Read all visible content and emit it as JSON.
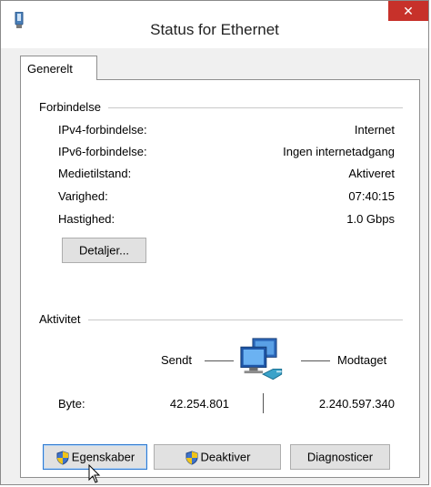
{
  "window": {
    "title": "Status for Ethernet",
    "close_glyph": "✕"
  },
  "tabs": [
    {
      "label": "Generelt"
    }
  ],
  "connection": {
    "section_label": "Forbindelse",
    "rows": [
      {
        "label": "IPv4-forbindelse:",
        "value": "Internet"
      },
      {
        "label": "IPv6-forbindelse:",
        "value": "Ingen internetadgang"
      },
      {
        "label": "Medietilstand:",
        "value": "Aktiveret"
      },
      {
        "label": "Varighed:",
        "value": "07:40:15"
      },
      {
        "label": "Hastighed:",
        "value": "1.0 Gbps"
      }
    ],
    "details_button": "Detaljer..."
  },
  "activity": {
    "section_label": "Aktivitet",
    "sent_label": "Sendt",
    "received_label": "Modtaget",
    "bytes_label": "Byte:",
    "bytes_sent": "42.254.801",
    "bytes_received": "2.240.597.340"
  },
  "buttons": {
    "properties": "Egenskaber",
    "disable": "Deaktiver",
    "diagnose": "Diagnosticer"
  },
  "icons": {
    "title": "network-adapter-icon",
    "activity": "network-computers-icon",
    "shield": "uac-shield-icon",
    "cursor": "mouse-pointer-icon"
  },
  "colors": {
    "close_button": "#c7312a",
    "focus_border": "#2f7ad0"
  }
}
